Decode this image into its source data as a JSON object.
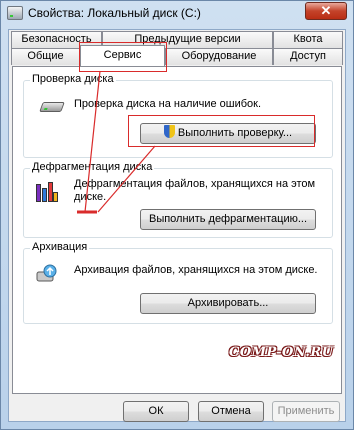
{
  "window": {
    "title": "Свойства: Локальный диск (C:)",
    "close_glyph": "✕"
  },
  "tabs": {
    "row1": [
      "Безопасность",
      "Предыдущие версии",
      "Квота"
    ],
    "row2": [
      "Общие",
      "Сервис",
      "Оборудование",
      "Доступ"
    ],
    "active": "Сервис"
  },
  "disk_check": {
    "title": "Проверка диска",
    "description": "Проверка диска на наличие ошибок.",
    "button": "Выполнить проверку..."
  },
  "defrag": {
    "title": "Дефрагментация диска",
    "description_line1": "Дефрагментация файлов, хранящихся на этом",
    "description_line2": "диске.",
    "button": "Выполнить дефрагментацию..."
  },
  "archive": {
    "title": "Архивация",
    "description": "Архивация файлов, хранящихся на этом диске.",
    "button": "Архивировать..."
  },
  "footer": {
    "ok": "ОК",
    "cancel": "Отмена",
    "apply": "Применить"
  },
  "watermark": "COMP-ON.RU",
  "colors": {
    "highlight": "#d92b2b",
    "close_button": "#c4432a"
  },
  "icons": [
    "window-drive-icon",
    "hard-disk-icon",
    "defrag-icon",
    "archive-icon",
    "uac-shield-icon"
  ]
}
